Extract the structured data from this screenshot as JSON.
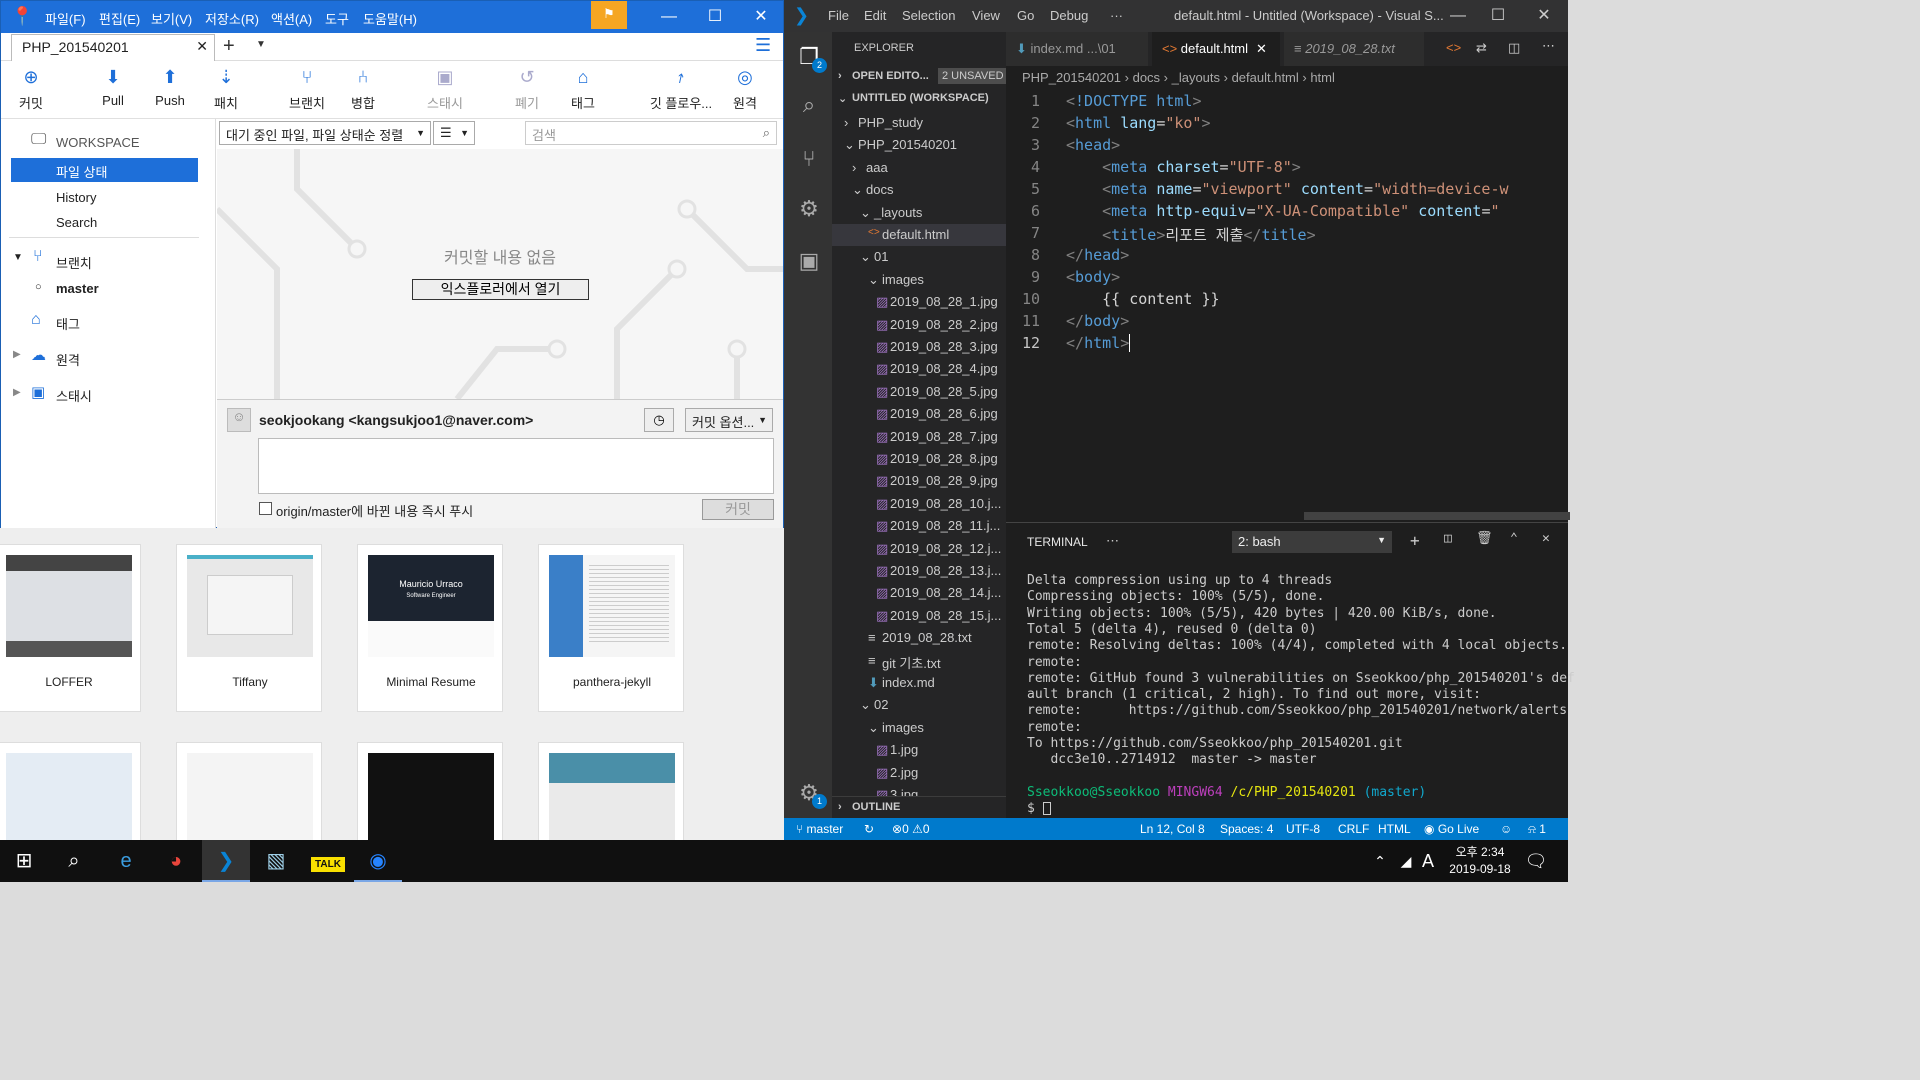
{
  "sourcetree": {
    "menu": [
      "파일(F)",
      "편집(E)",
      "보기(V)",
      "저장소(R)",
      "액션(A)",
      "도구",
      "도움말(H)"
    ],
    "tab": "PHP_201540201",
    "toolbar": [
      "커밋",
      "Pull",
      "Push",
      "패치",
      "브랜치",
      "병합",
      "스태시",
      "폐기",
      "태그",
      "깃 플로우...",
      "원격"
    ],
    "sidebar": {
      "workspace": "WORKSPACE",
      "file_status": "파일 상태",
      "history": "History",
      "search": "Search",
      "branches": "브랜치",
      "master": "master",
      "tags": "태그",
      "remotes": "원격",
      "stashes": "스태시"
    },
    "filter_select": "대기 중인 파일, 파일 상태순 정렬",
    "search_placeholder": "검색",
    "empty_message": "커밋할 내용 없음",
    "open_explorer": "익스플로러에서 열기",
    "author": "seokjookang <kangsukjoo1@naver.com>",
    "commit_options": "커밋 옵션...",
    "push_checkbox": "origin/master에 바뀐 내용 즉시 푸시",
    "commit_button": "커밋"
  },
  "themes": [
    "LOFFER",
    "Tiffany",
    "Minimal Resume",
    "panthera-jekyll"
  ],
  "theme_text": {
    "mauricio": "Mauricio Urraco",
    "software_engineer": "Software Engineer"
  },
  "vscode": {
    "menu": [
      "File",
      "Edit",
      "Selection",
      "View",
      "Go",
      "Debug",
      "···"
    ],
    "title": "default.html - Untitled (Workspace) - Visual S...",
    "explorer_title": "EXPLORER",
    "open_editors": "OPEN EDITO...",
    "unsaved": "2 UNSAVED",
    "workspace": "UNTITLED (WORKSPACE)",
    "tree": [
      "PHP_study",
      "PHP_201540201",
      "aaa",
      "docs",
      "_layouts",
      "default.html",
      "01",
      "images",
      "2019_08_28_1.jpg",
      "2019_08_28_2.jpg",
      "2019_08_28_3.jpg",
      "2019_08_28_4.jpg",
      "2019_08_28_5.jpg",
      "2019_08_28_6.jpg",
      "2019_08_28_7.jpg",
      "2019_08_28_8.jpg",
      "2019_08_28_9.jpg",
      "2019_08_28_10.j...",
      "2019_08_28_11.j...",
      "2019_08_28_12.j...",
      "2019_08_28_13.j...",
      "2019_08_28_14.j...",
      "2019_08_28_15.j...",
      "2019_08_28.txt",
      "git 기초.txt",
      "index.md",
      "02",
      "images",
      "1.jpg",
      "2.jpg",
      "3.jpg"
    ],
    "outline": "OUTLINE",
    "tabs": [
      "index.md ...\\01",
      "default.html",
      "2019_08_28.txt"
    ],
    "breadcrumb": "PHP_201540201 › docs › _layouts › default.html › html",
    "code_lines": [
      "1",
      "2",
      "3",
      "4",
      "5",
      "6",
      "7",
      "8",
      "9",
      "10",
      "11",
      "12"
    ],
    "terminal_title": "TERMINAL",
    "terminal_select": "2: bash",
    "terminal": [
      "Delta compression using up to 4 threads",
      "Compressing objects: 100% (5/5), done.",
      "Writing objects: 100% (5/5), 420 bytes | 420.00 KiB/s, done.",
      "Total 5 (delta 4), reused 0 (delta 0)",
      "remote: Resolving deltas: 100% (4/4), completed with 4 local objects.",
      "remote:",
      "remote: GitHub found 3 vulnerabilities on Sseokkoo/php_201540201's def",
      "ault branch (1 critical, 2 high). To find out more, visit:",
      "remote:      https://github.com/Sseokkoo/php_201540201/network/alerts",
      "remote:",
      "To https://github.com/Sseokkoo/php_201540201.git",
      "   dcc3e10..2714912  master -> master"
    ],
    "prompt_user": "Sseokkoo@Sseokkoo",
    "prompt_env": "MINGW64",
    "prompt_path": "/c/PHP_201540201",
    "prompt_branch": "(master)",
    "prompt_symbol": "$",
    "status": {
      "branch": "master",
      "errors": "0",
      "warnings": "0",
      "position": "Ln 12, Col 8",
      "spaces": "Spaces: 4",
      "encoding": "UTF-8",
      "eol": "CRLF",
      "language": "HTML",
      "golive": "Go Live",
      "notifications": "1"
    },
    "explorer_badge": "2",
    "settings_badge": "1"
  },
  "taskbar": {
    "time": "오후 2:34",
    "date": "2019-09-18",
    "ime": "A"
  }
}
